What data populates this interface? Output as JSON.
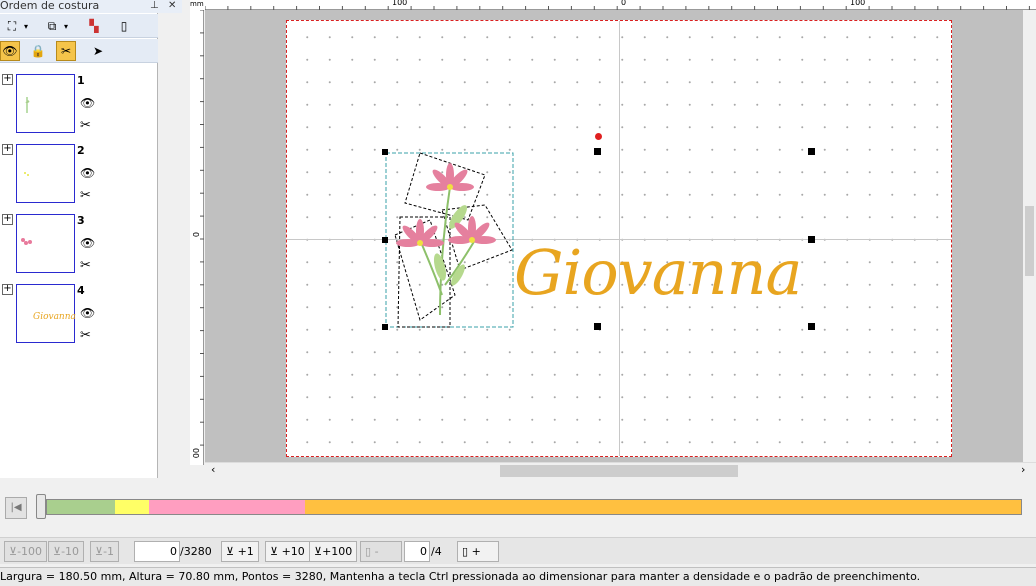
{
  "panel": {
    "title": "Ordem de costura",
    "items": [
      {
        "num": "1",
        "mini": ""
      },
      {
        "num": "2",
        "mini": ""
      },
      {
        "num": "3",
        "mini": ""
      },
      {
        "num": "4",
        "mini": "Giovanna"
      }
    ]
  },
  "ruler": {
    "unit": "mm",
    "top_labels": [
      "100",
      "0",
      "100"
    ],
    "left_labels": [
      "0",
      "00"
    ]
  },
  "design": {
    "text": "Giovanna",
    "text_color": "#e8a520"
  },
  "colorbar": {
    "segments": [
      {
        "color": "#a9cf8e",
        "fraction": 0.07
      },
      {
        "color": "#ffff66",
        "fraction": 0.035
      },
      {
        "color": "#ff9ec0",
        "fraction": 0.16
      },
      {
        "color": "#ffc040",
        "fraction": 0.735
      }
    ]
  },
  "bottom": {
    "b1": "-100",
    "b2": "-10",
    "b3": "-1",
    "stitch_value": "0",
    "stitch_total": "/3280",
    "f1": "+1",
    "f2": "+10",
    "f3": "+100",
    "minus": "-",
    "color_value": "0",
    "color_total": "/4",
    "plus": "+"
  },
  "status": "Largura = 180.50 mm, Altura = 70.80 mm, Pontos = 3280, Mantenha a tecla Ctrl pressionada ao dimensionar para manter a densidade e o padrão de preenchimento."
}
